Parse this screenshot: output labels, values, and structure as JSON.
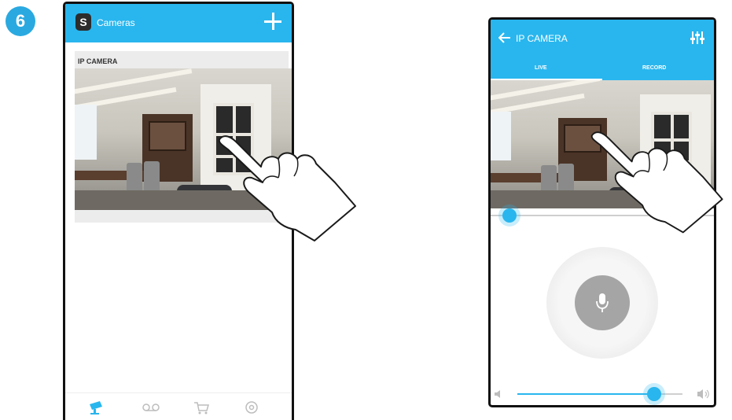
{
  "step_number": "6",
  "left_screen": {
    "app_title": "Cameras",
    "logo_letter": "S",
    "add_icon": "plus-icon",
    "camera_card": {
      "label": "IP CAMERA"
    },
    "bottom_nav": [
      "camera-icon",
      "voicemail-icon",
      "cart-icon",
      "settings-icon"
    ]
  },
  "right_screen": {
    "title": "IP CAMERA",
    "back_icon": "arrow-left-icon",
    "settings_icon": "equalizer-icon",
    "tabs": [
      "LIVE",
      "RECORD"
    ],
    "active_tab": "LIVE",
    "playback_position": 0.0,
    "volume_level": 0.83,
    "mic_icon": "microphone-icon"
  },
  "colors": {
    "accent": "#29b6ee",
    "step_badge": "#2aa9e0",
    "mic_button": "#a5a5a5"
  }
}
